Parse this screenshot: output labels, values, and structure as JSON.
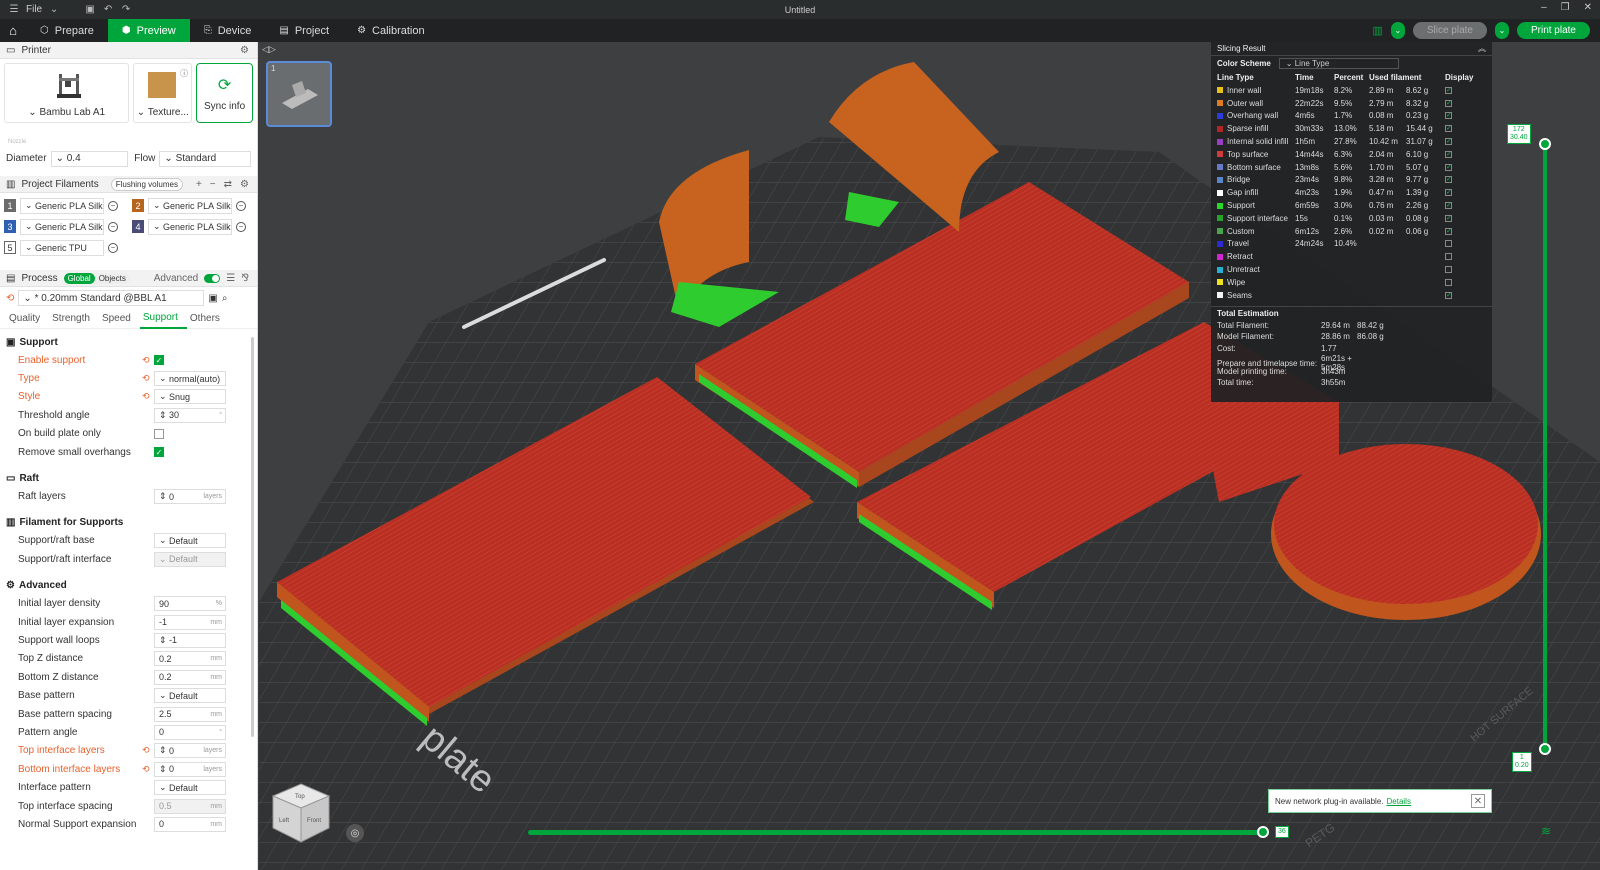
{
  "window": {
    "title": "Untitled",
    "menu_file": "File"
  },
  "toolbar": {
    "tabs": [
      {
        "label": "Prepare",
        "icon": "prepare-icon"
      },
      {
        "label": "Preview",
        "icon": "preview-icon"
      },
      {
        "label": "Device",
        "icon": "device-icon"
      },
      {
        "label": "Project",
        "icon": "project-icon"
      },
      {
        "label": "Calibration",
        "icon": "calibration-icon"
      }
    ],
    "slice_label": "Slice plate",
    "print_label": "Print plate"
  },
  "printer": {
    "section_title": "Printer",
    "printer_name": "Bambu Lab A1",
    "plate_name": "Texture...",
    "sync_label": "Sync info",
    "nozzle_hint": "Nozzle",
    "diameter_label": "Diameter",
    "diameter_value": "0.4",
    "flow_label": "Flow",
    "flow_value": "Standard"
  },
  "filaments": {
    "section_title": "Project Filaments",
    "flushing_label": "Flushing volumes",
    "items": [
      {
        "num": "1",
        "name": "Generic PLA Silk",
        "color": "#6b6b6b"
      },
      {
        "num": "2",
        "name": "Generic PLA Silk",
        "color": "#b5651d"
      },
      {
        "num": "3",
        "name": "Generic PLA Silk",
        "color": "#2f5fb3"
      },
      {
        "num": "4",
        "name": "Generic PLA Silk",
        "color": "#4b4b78"
      },
      {
        "num": "5",
        "name": "Generic TPU",
        "color": "#ffffff"
      }
    ]
  },
  "process": {
    "section_title": "Process",
    "global_label": "Global",
    "objects_label": "Objects",
    "advanced_label": "Advanced",
    "preset": "* 0.20mm Standard @BBL A1",
    "tabs": [
      "Quality",
      "Strength",
      "Speed",
      "Support",
      "Others"
    ],
    "active_tab": "Support"
  },
  "support": {
    "group": "Support",
    "enable": "Enable support",
    "type_label": "Type",
    "type_value": "normal(auto)",
    "style_label": "Style",
    "style_value": "Snug",
    "threshold_label": "Threshold angle",
    "threshold_value": "30",
    "threshold_unit": "°",
    "build_plate_only": "On build plate only",
    "remove_small": "Remove small overhangs"
  },
  "raft": {
    "group": "Raft",
    "layers_label": "Raft layers",
    "layers_value": "0",
    "unit": "layers"
  },
  "filament_supports": {
    "group": "Filament for Supports",
    "base_label": "Support/raft base",
    "base_value": "Default",
    "interface_label": "Support/raft interface",
    "interface_value": "Default"
  },
  "advanced": {
    "group": "Advanced",
    "rows": [
      {
        "label": "Initial layer density",
        "value": "90",
        "unit": "%"
      },
      {
        "label": "Initial layer expansion",
        "value": "-1",
        "unit": "mm"
      },
      {
        "label": "Support wall loops",
        "value": "-1",
        "unit": ""
      },
      {
        "label": "Top Z distance",
        "value": "0.2",
        "unit": "mm"
      },
      {
        "label": "Bottom Z distance",
        "value": "0.2",
        "unit": "mm"
      },
      {
        "label": "Base pattern",
        "value": "Default",
        "unit": ""
      },
      {
        "label": "Base pattern spacing",
        "value": "2.5",
        "unit": "mm"
      },
      {
        "label": "Pattern angle",
        "value": "0",
        "unit": "°"
      },
      {
        "label": "Top interface layers",
        "value": "0",
        "unit": "layers"
      },
      {
        "label": "Bottom interface layers",
        "value": "0",
        "unit": "layers"
      },
      {
        "label": "Interface pattern",
        "value": "Default",
        "unit": ""
      },
      {
        "label": "Top interface spacing",
        "value": "0.5",
        "unit": "mm"
      },
      {
        "label": "Normal Support expansion",
        "value": "0",
        "unit": "mm"
      }
    ]
  },
  "result": {
    "title": "Slicing Result",
    "color_scheme_label": "Color Scheme",
    "color_scheme_value": "Line Type",
    "headers": [
      "Line Type",
      "Time",
      "Percent",
      "Used filament",
      "Display"
    ],
    "rows": [
      {
        "name": "Inner wall",
        "color": "#e8c21a",
        "time": "19m18s",
        "pct": "8.2%",
        "len": "2.89 m",
        "g": "8.62 g",
        "show": "✓"
      },
      {
        "name": "Outer wall",
        "color": "#e07a22",
        "time": "22m22s",
        "pct": "9.5%",
        "len": "2.79 m",
        "g": "8.32 g",
        "show": "✓"
      },
      {
        "name": "Overhang wall",
        "color": "#2a3dd8",
        "time": "4m6s",
        "pct": "1.7%",
        "len": "0.08 m",
        "g": "0.23 g",
        "show": "✓"
      },
      {
        "name": "Sparse infill",
        "color": "#b32424",
        "time": "30m33s",
        "pct": "13.0%",
        "len": "5.18 m",
        "g": "15.44 g",
        "show": "✓"
      },
      {
        "name": "Internal solid infill",
        "color": "#9a3fc2",
        "time": "1h5m",
        "pct": "27.8%",
        "len": "10.42 m",
        "g": "31.07 g",
        "show": "✓"
      },
      {
        "name": "Top surface",
        "color": "#d03a3a",
        "time": "14m44s",
        "pct": "6.3%",
        "len": "2.04 m",
        "g": "6.10 g",
        "show": "✓"
      },
      {
        "name": "Bottom surface",
        "color": "#6a78c8",
        "time": "13m8s",
        "pct": "5.6%",
        "len": "1.70 m",
        "g": "5.07 g",
        "show": "✓"
      },
      {
        "name": "Bridge",
        "color": "#5a86c8",
        "time": "23m4s",
        "pct": "9.8%",
        "len": "3.28 m",
        "g": "9.77 g",
        "show": "✓"
      },
      {
        "name": "Gap infill",
        "color": "#ffffff",
        "time": "4m23s",
        "pct": "1.9%",
        "len": "0.47 m",
        "g": "1.39 g",
        "show": "✓"
      },
      {
        "name": "Support",
        "color": "#26d926",
        "time": "6m59s",
        "pct": "3.0%",
        "len": "0.76 m",
        "g": "2.26 g",
        "show": "✓"
      },
      {
        "name": "Support interface",
        "color": "#2aa12a",
        "time": "15s",
        "pct": "0.1%",
        "len": "0.03 m",
        "g": "0.08 g",
        "show": "✓"
      },
      {
        "name": "Custom",
        "color": "#4aa54a",
        "time": "6m12s",
        "pct": "2.6%",
        "len": "0.02 m",
        "g": "0.06 g",
        "show": "✓"
      },
      {
        "name": "Travel",
        "color": "#2b2bd0",
        "time": "24m24s",
        "pct": "10.4%",
        "len": "",
        "g": "",
        "show": ""
      },
      {
        "name": "Retract",
        "color": "#d026d0",
        "time": "",
        "pct": "",
        "len": "",
        "g": "",
        "show": ""
      },
      {
        "name": "Unretract",
        "color": "#26b0d0",
        "time": "",
        "pct": "",
        "len": "",
        "g": "",
        "show": ""
      },
      {
        "name": "Wipe",
        "color": "#f0e020",
        "time": "",
        "pct": "",
        "len": "",
        "g": "",
        "show": ""
      },
      {
        "name": "Seams",
        "color": "#f2f2f2",
        "time": "",
        "pct": "",
        "len": "",
        "g": "",
        "show": "✓"
      }
    ],
    "estimation_title": "Total Estimation",
    "estimation": [
      {
        "label": "Total Filament:",
        "a": "29.64 m",
        "b": "88.42 g"
      },
      {
        "label": "Model Filament:",
        "a": "28.86 m",
        "b": "86.08 g"
      },
      {
        "label": "Cost:",
        "a": "1.77",
        "b": ""
      },
      {
        "label": "Prepare and timelapse time:",
        "a": "6m21s + 5m28s",
        "b": ""
      },
      {
        "label": "Model printing time:",
        "a": "3h43m",
        "b": ""
      },
      {
        "label": "Total time:",
        "a": "3h55m",
        "b": ""
      }
    ]
  },
  "slider": {
    "top_label_1": "172",
    "top_label_2": "30.40",
    "bottom_label_1": "1",
    "bottom_label_2": "0.20",
    "h_label": "36"
  },
  "notice": {
    "text": "New network plug-in available.",
    "link": "Details"
  },
  "plate_text": "plate",
  "bed_text": "HOT SURFACE",
  "corner_text": "PETG",
  "cube": {
    "top": "Top",
    "left": "Left",
    "front": "Front"
  }
}
